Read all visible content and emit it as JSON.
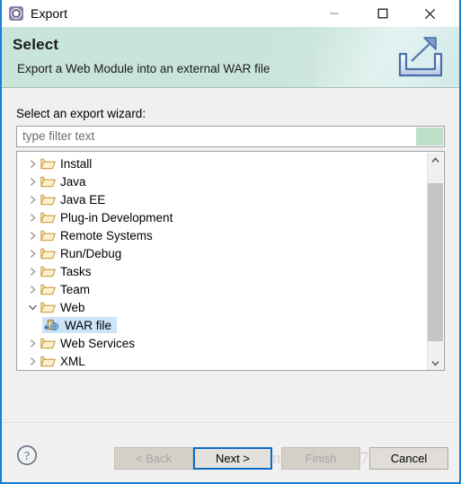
{
  "window": {
    "title": "Export",
    "icon": "export-gear-icon",
    "accent_border": "#1a7fd4",
    "controls": {
      "minimize": "minimize-icon",
      "maximize": "maximize-icon",
      "close": "close-icon"
    }
  },
  "header": {
    "title": "Select",
    "description": "Export a Web Module into an external WAR file",
    "graphic": "export-tray-arrow-icon",
    "background": "#c9e4d8"
  },
  "form": {
    "wizard_label": "Select an export wizard:",
    "filter": {
      "value": "",
      "placeholder": "type filter text",
      "accent_color": "#bfe0c8"
    }
  },
  "tree": {
    "selection_color": "#cce4f7",
    "items": [
      {
        "label": "Install",
        "icon": "folder-icon",
        "twisty": "chevron-right-icon",
        "expanded": false,
        "level": 0,
        "selected": false
      },
      {
        "label": "Java",
        "icon": "folder-icon",
        "twisty": "chevron-right-icon",
        "expanded": false,
        "level": 0,
        "selected": false
      },
      {
        "label": "Java EE",
        "icon": "folder-icon",
        "twisty": "chevron-right-icon",
        "expanded": false,
        "level": 0,
        "selected": false
      },
      {
        "label": "Plug-in Development",
        "icon": "folder-icon",
        "twisty": "chevron-right-icon",
        "expanded": false,
        "level": 0,
        "selected": false
      },
      {
        "label": "Remote Systems",
        "icon": "folder-icon",
        "twisty": "chevron-right-icon",
        "expanded": false,
        "level": 0,
        "selected": false
      },
      {
        "label": "Run/Debug",
        "icon": "folder-icon",
        "twisty": "chevron-right-icon",
        "expanded": false,
        "level": 0,
        "selected": false
      },
      {
        "label": "Tasks",
        "icon": "folder-icon",
        "twisty": "chevron-right-icon",
        "expanded": false,
        "level": 0,
        "selected": false
      },
      {
        "label": "Team",
        "icon": "folder-icon",
        "twisty": "chevron-right-icon",
        "expanded": false,
        "level": 0,
        "selected": false
      },
      {
        "label": "Web",
        "icon": "folder-icon",
        "twisty": "chevron-down-icon",
        "expanded": true,
        "level": 0,
        "selected": false
      },
      {
        "label": "WAR file",
        "icon": "war-file-icon",
        "twisty": "none",
        "expanded": false,
        "level": 1,
        "selected": true
      },
      {
        "label": "Web Services",
        "icon": "folder-icon",
        "twisty": "chevron-right-icon",
        "expanded": false,
        "level": 0,
        "selected": false
      },
      {
        "label": "XML",
        "icon": "folder-icon",
        "twisty": "chevron-right-icon",
        "expanded": false,
        "level": 0,
        "selected": false
      }
    ],
    "scrollbar": {
      "up": "scroll-up-arrow-icon",
      "down": "scroll-down-arrow-icon"
    }
  },
  "footer": {
    "help_icon": "help-question-icon",
    "buttons": {
      "back": {
        "label": "< Back",
        "enabled": false
      },
      "next": {
        "label": "Next >",
        "enabled": true,
        "focused": true,
        "focus_color": "#0a6cc4"
      },
      "finish": {
        "label": "Finish",
        "enabled": false
      },
      "cancel": {
        "label": "Cancel",
        "enabled": true
      }
    }
  },
  "watermark": {
    "text": "https://blog.csdn.net/sx_jz9705?21"
  }
}
